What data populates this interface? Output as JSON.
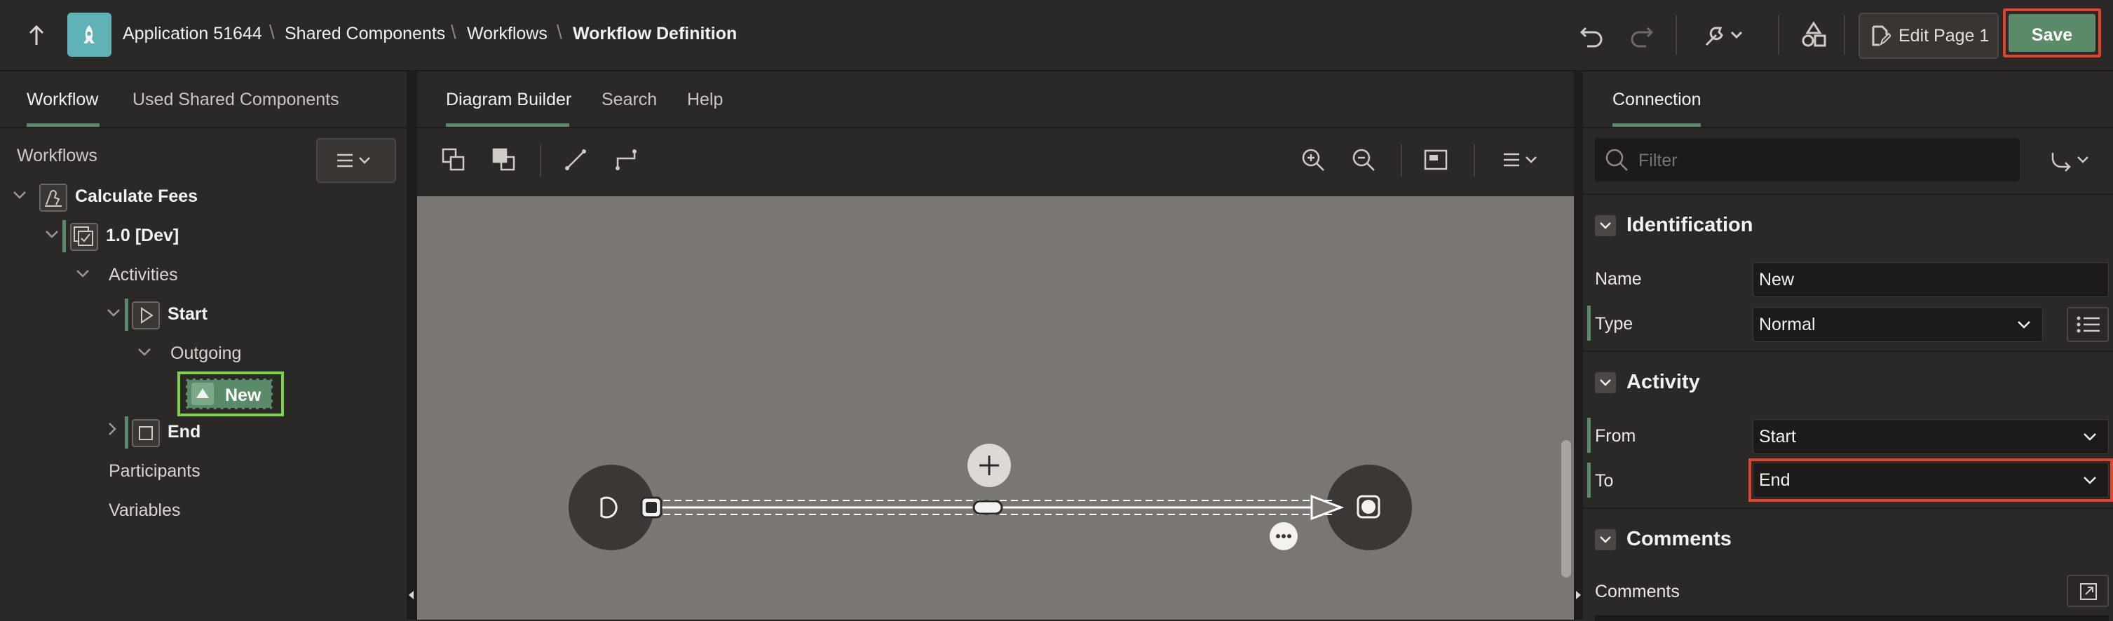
{
  "topbar": {
    "breadcrumb": [
      "Application 51644",
      "Shared Components",
      "Workflows",
      "Workflow Definition"
    ],
    "edit_page_label": "Edit Page 1",
    "save_label": "Save"
  },
  "left": {
    "tabs": [
      "Workflow",
      "Used Shared Components"
    ],
    "tree_heading": "Workflows",
    "tree": {
      "workflow": "Calculate Fees",
      "version": "1.0 [Dev]",
      "activities": "Activities",
      "start": "Start",
      "outgoing": "Outgoing",
      "connection": "New",
      "end": "End",
      "participants": "Participants",
      "variables": "Variables"
    }
  },
  "middle": {
    "tabs": [
      "Diagram Builder",
      "Search",
      "Help"
    ]
  },
  "right": {
    "tab": "Connection",
    "filter_placeholder": "Filter",
    "identification": {
      "heading": "Identification",
      "name_label": "Name",
      "name_value": "New",
      "type_label": "Type",
      "type_value": "Normal"
    },
    "activity": {
      "heading": "Activity",
      "from_label": "From",
      "from_value": "Start",
      "to_label": "To",
      "to_value": "End"
    },
    "comments": {
      "heading": "Comments",
      "label": "Comments"
    }
  },
  "colors": {
    "accent_green": "#5a8a67",
    "highlight_red": "#e0442e",
    "highlight_green": "#7bd34a"
  },
  "icons": [
    "up-arrow-icon",
    "app-icon",
    "undo-icon",
    "redo-icon",
    "wrench-icon",
    "shapes-icon",
    "edit-page-icon",
    "menu-icon",
    "zoom-in-icon",
    "zoom-out-icon",
    "fit-icon",
    "search-icon",
    "connection-type-icon"
  ]
}
